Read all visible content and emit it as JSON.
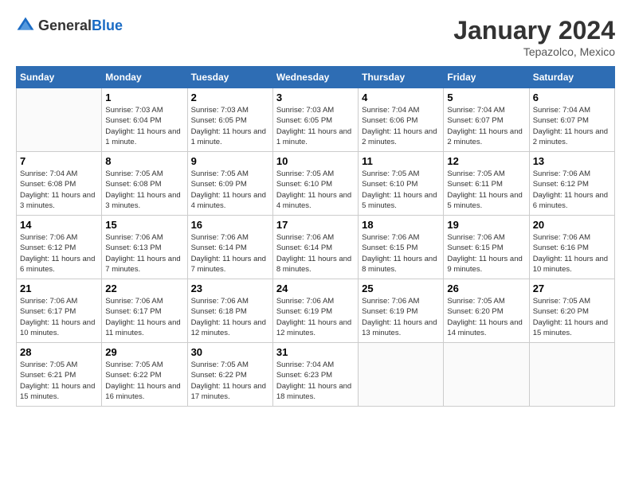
{
  "header": {
    "logo_general": "General",
    "logo_blue": "Blue",
    "month_year": "January 2024",
    "location": "Tepazolco, Mexico"
  },
  "columns": [
    "Sunday",
    "Monday",
    "Tuesday",
    "Wednesday",
    "Thursday",
    "Friday",
    "Saturday"
  ],
  "weeks": [
    [
      {
        "day": "",
        "content": ""
      },
      {
        "day": "1",
        "content": "Sunrise: 7:03 AM\nSunset: 6:04 PM\nDaylight: 11 hours and 1 minute."
      },
      {
        "day": "2",
        "content": "Sunrise: 7:03 AM\nSunset: 6:05 PM\nDaylight: 11 hours and 1 minute."
      },
      {
        "day": "3",
        "content": "Sunrise: 7:03 AM\nSunset: 6:05 PM\nDaylight: 11 hours and 1 minute."
      },
      {
        "day": "4",
        "content": "Sunrise: 7:04 AM\nSunset: 6:06 PM\nDaylight: 11 hours and 2 minutes."
      },
      {
        "day": "5",
        "content": "Sunrise: 7:04 AM\nSunset: 6:07 PM\nDaylight: 11 hours and 2 minutes."
      },
      {
        "day": "6",
        "content": "Sunrise: 7:04 AM\nSunset: 6:07 PM\nDaylight: 11 hours and 2 minutes."
      }
    ],
    [
      {
        "day": "7",
        "content": "Sunrise: 7:04 AM\nSunset: 6:08 PM\nDaylight: 11 hours and 3 minutes."
      },
      {
        "day": "8",
        "content": "Sunrise: 7:05 AM\nSunset: 6:08 PM\nDaylight: 11 hours and 3 minutes."
      },
      {
        "day": "9",
        "content": "Sunrise: 7:05 AM\nSunset: 6:09 PM\nDaylight: 11 hours and 4 minutes."
      },
      {
        "day": "10",
        "content": "Sunrise: 7:05 AM\nSunset: 6:10 PM\nDaylight: 11 hours and 4 minutes."
      },
      {
        "day": "11",
        "content": "Sunrise: 7:05 AM\nSunset: 6:10 PM\nDaylight: 11 hours and 5 minutes."
      },
      {
        "day": "12",
        "content": "Sunrise: 7:05 AM\nSunset: 6:11 PM\nDaylight: 11 hours and 5 minutes."
      },
      {
        "day": "13",
        "content": "Sunrise: 7:06 AM\nSunset: 6:12 PM\nDaylight: 11 hours and 6 minutes."
      }
    ],
    [
      {
        "day": "14",
        "content": "Sunrise: 7:06 AM\nSunset: 6:12 PM\nDaylight: 11 hours and 6 minutes."
      },
      {
        "day": "15",
        "content": "Sunrise: 7:06 AM\nSunset: 6:13 PM\nDaylight: 11 hours and 7 minutes."
      },
      {
        "day": "16",
        "content": "Sunrise: 7:06 AM\nSunset: 6:14 PM\nDaylight: 11 hours and 7 minutes."
      },
      {
        "day": "17",
        "content": "Sunrise: 7:06 AM\nSunset: 6:14 PM\nDaylight: 11 hours and 8 minutes."
      },
      {
        "day": "18",
        "content": "Sunrise: 7:06 AM\nSunset: 6:15 PM\nDaylight: 11 hours and 8 minutes."
      },
      {
        "day": "19",
        "content": "Sunrise: 7:06 AM\nSunset: 6:15 PM\nDaylight: 11 hours and 9 minutes."
      },
      {
        "day": "20",
        "content": "Sunrise: 7:06 AM\nSunset: 6:16 PM\nDaylight: 11 hours and 10 minutes."
      }
    ],
    [
      {
        "day": "21",
        "content": "Sunrise: 7:06 AM\nSunset: 6:17 PM\nDaylight: 11 hours and 10 minutes."
      },
      {
        "day": "22",
        "content": "Sunrise: 7:06 AM\nSunset: 6:17 PM\nDaylight: 11 hours and 11 minutes."
      },
      {
        "day": "23",
        "content": "Sunrise: 7:06 AM\nSunset: 6:18 PM\nDaylight: 11 hours and 12 minutes."
      },
      {
        "day": "24",
        "content": "Sunrise: 7:06 AM\nSunset: 6:19 PM\nDaylight: 11 hours and 12 minutes."
      },
      {
        "day": "25",
        "content": "Sunrise: 7:06 AM\nSunset: 6:19 PM\nDaylight: 11 hours and 13 minutes."
      },
      {
        "day": "26",
        "content": "Sunrise: 7:05 AM\nSunset: 6:20 PM\nDaylight: 11 hours and 14 minutes."
      },
      {
        "day": "27",
        "content": "Sunrise: 7:05 AM\nSunset: 6:20 PM\nDaylight: 11 hours and 15 minutes."
      }
    ],
    [
      {
        "day": "28",
        "content": "Sunrise: 7:05 AM\nSunset: 6:21 PM\nDaylight: 11 hours and 15 minutes."
      },
      {
        "day": "29",
        "content": "Sunrise: 7:05 AM\nSunset: 6:22 PM\nDaylight: 11 hours and 16 minutes."
      },
      {
        "day": "30",
        "content": "Sunrise: 7:05 AM\nSunset: 6:22 PM\nDaylight: 11 hours and 17 minutes."
      },
      {
        "day": "31",
        "content": "Sunrise: 7:04 AM\nSunset: 6:23 PM\nDaylight: 11 hours and 18 minutes."
      },
      {
        "day": "",
        "content": ""
      },
      {
        "day": "",
        "content": ""
      },
      {
        "day": "",
        "content": ""
      }
    ]
  ]
}
